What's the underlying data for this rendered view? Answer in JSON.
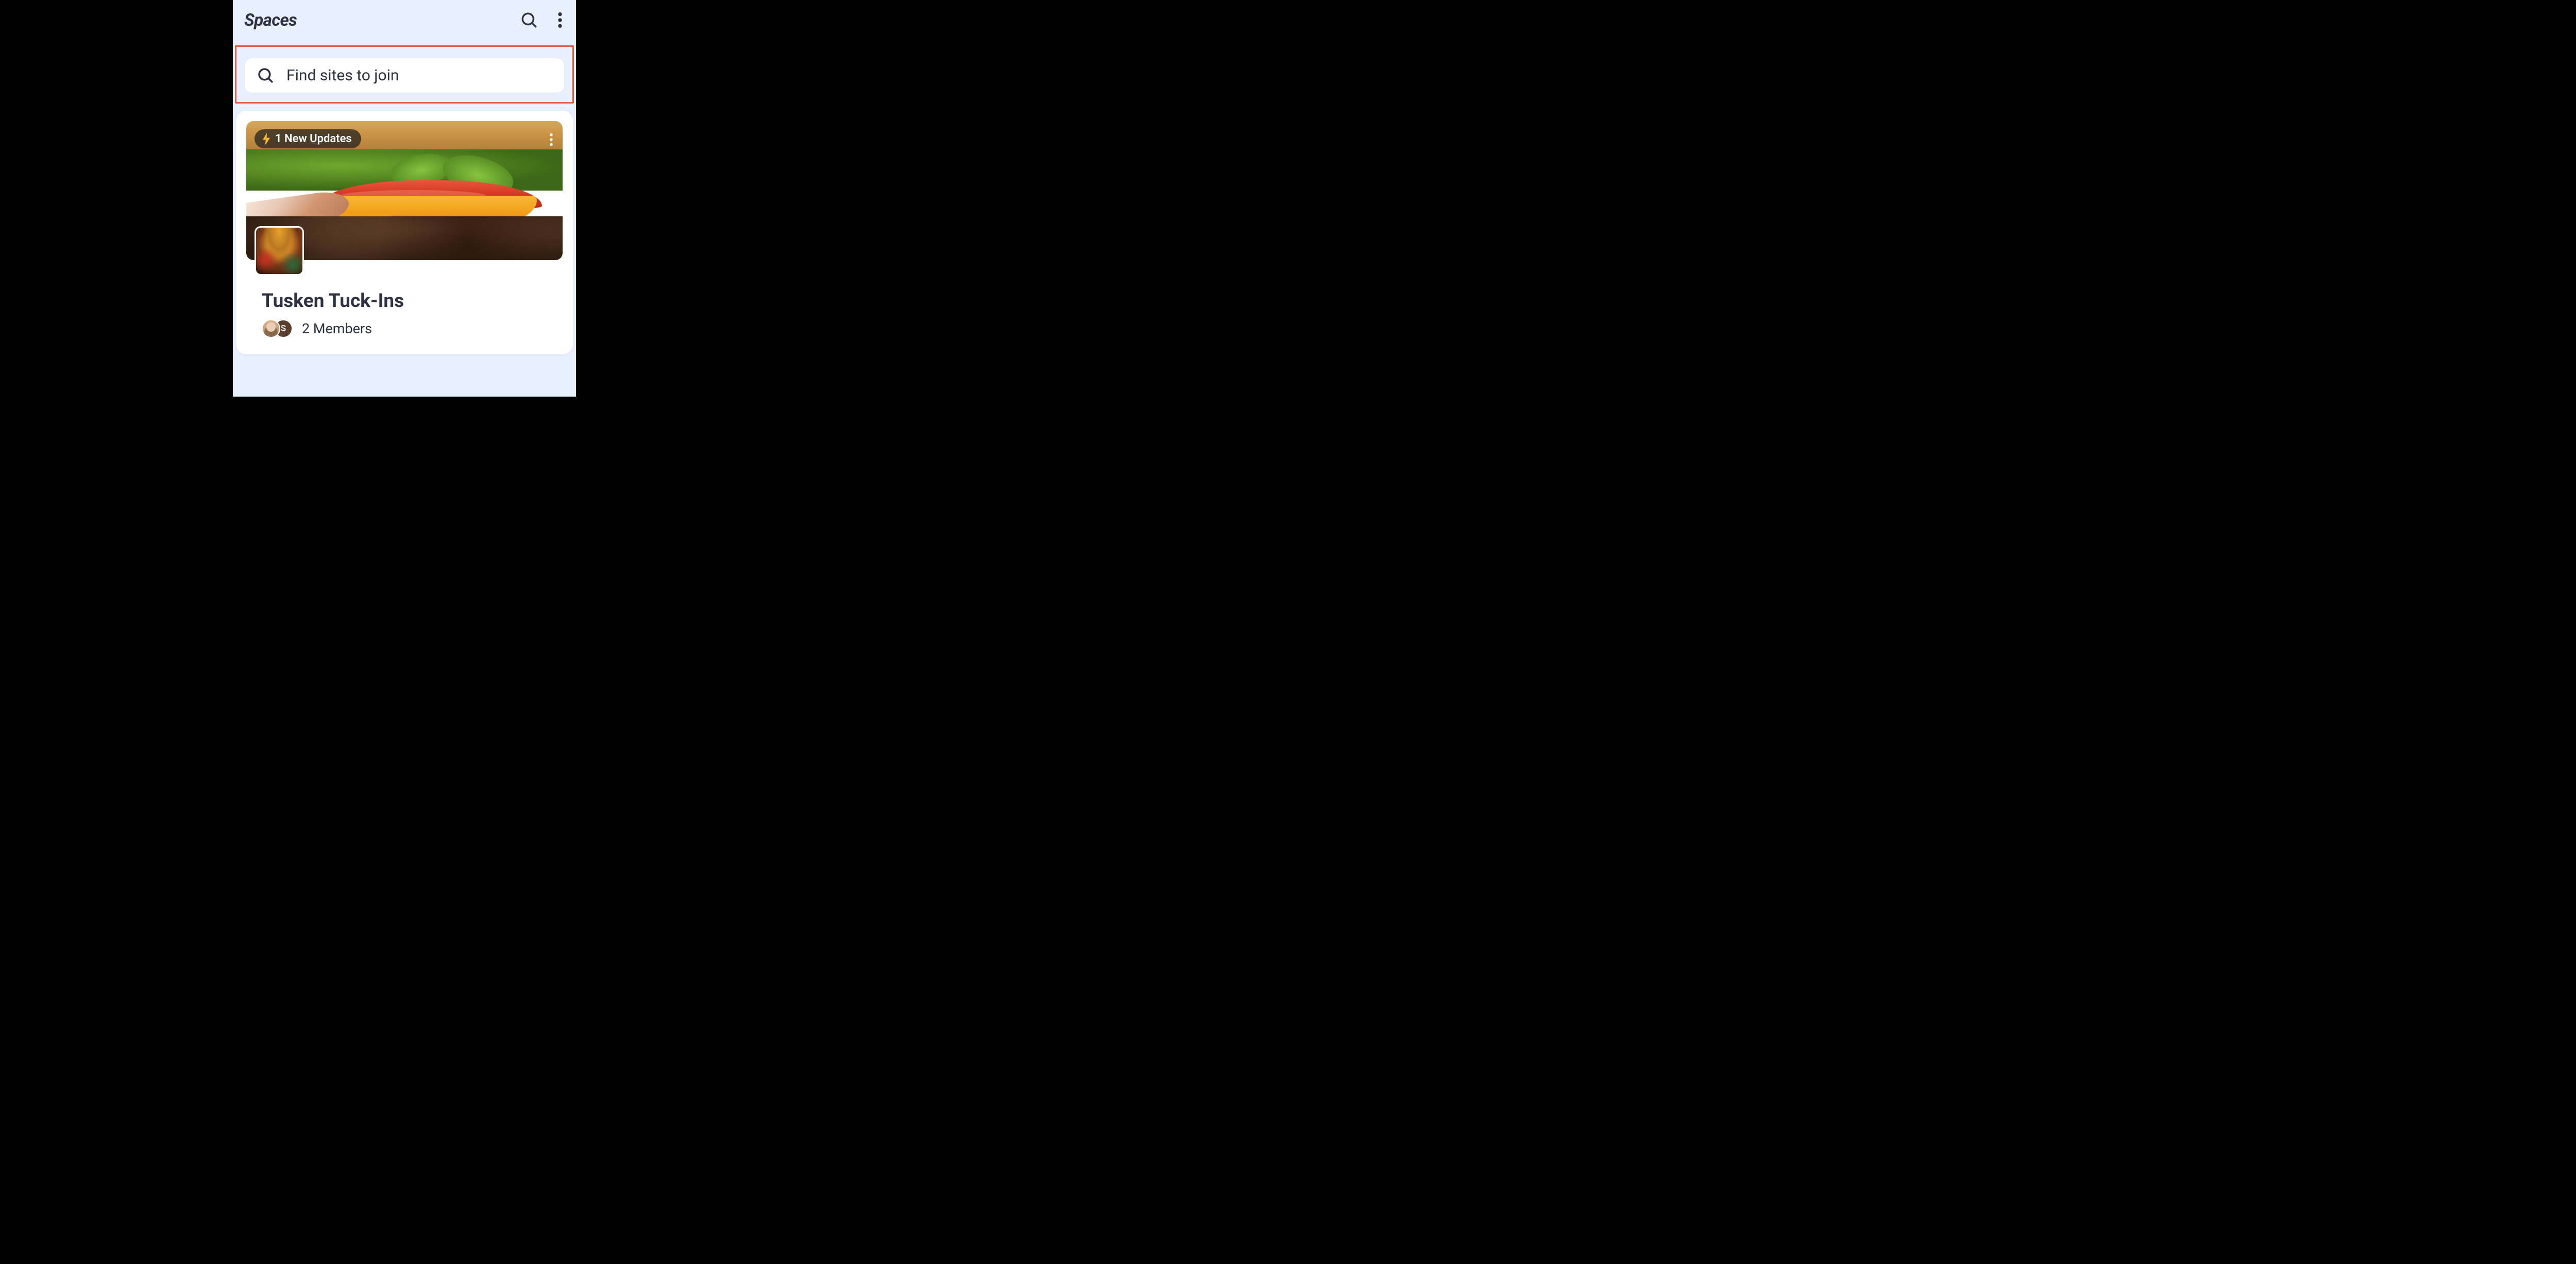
{
  "header": {
    "title": "Spaces"
  },
  "search": {
    "placeholder": "Find sites to join"
  },
  "card": {
    "updates_badge": "1 New Updates",
    "title": "Tusken Tuck-Ins",
    "members_text": "2 Members",
    "avatar_initial": "S"
  },
  "colors": {
    "highlight_border": "#e85c3f",
    "bg": "#e8efff",
    "text": "#2d3142",
    "bolt": "#f7b833"
  }
}
